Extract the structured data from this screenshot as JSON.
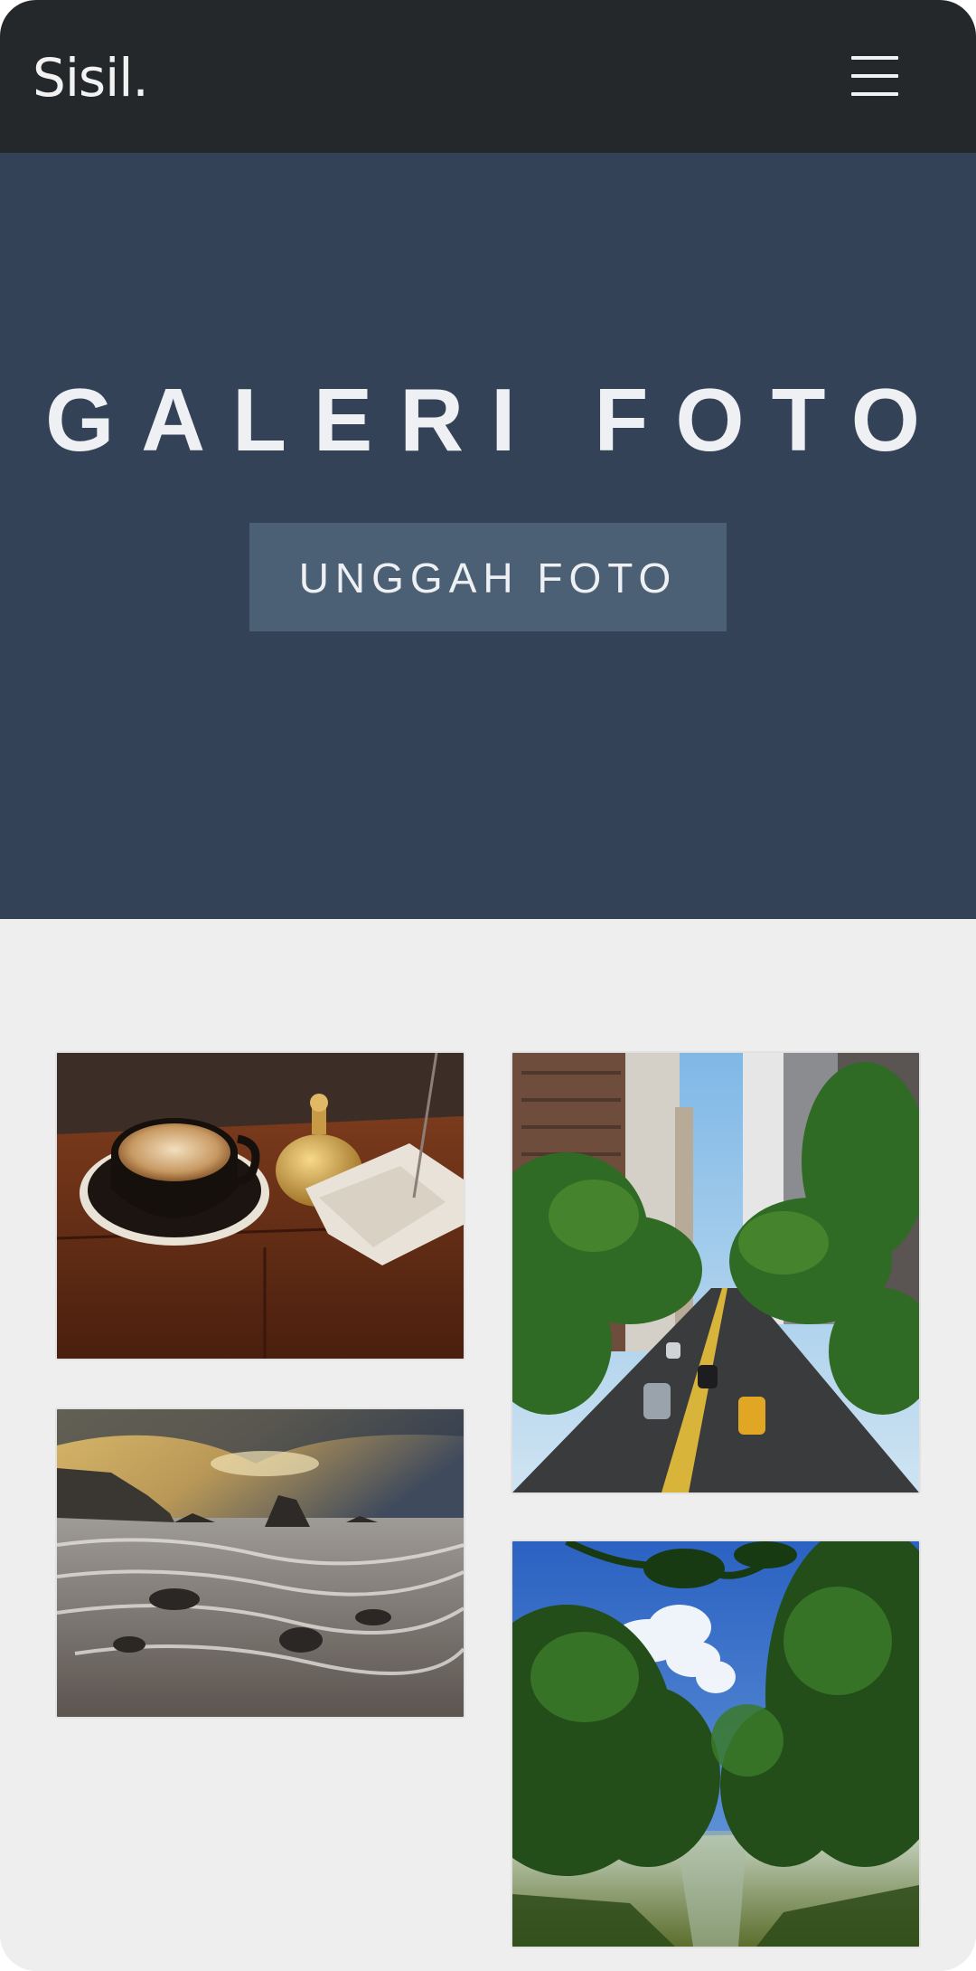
{
  "navbar": {
    "brand": "Sisil.",
    "menu_icon": "hamburger-menu-icon"
  },
  "hero": {
    "title": "GALERI FOTO",
    "upload_button": "UNGGAH FOTO"
  },
  "gallery": {
    "photos": [
      {
        "subject": "latte-art-coffee-with-bell-and-receipts"
      },
      {
        "subject": "city-street-with-trees-and-skyscrapers"
      },
      {
        "subject": "rocky-seashore-at-sunset"
      },
      {
        "subject": "river-between-green-trees"
      }
    ]
  },
  "colors": {
    "navbar_bg": "#25282b",
    "hero_bg": "#344257",
    "button_bg": "#4b6074",
    "page_bg": "#eeeeee"
  }
}
